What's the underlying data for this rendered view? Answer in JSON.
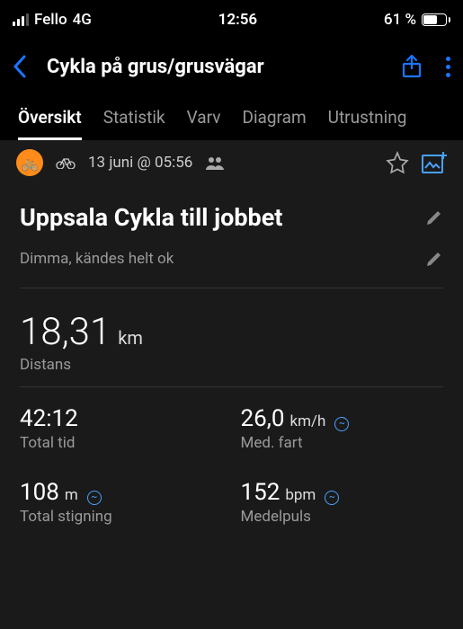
{
  "status": {
    "carrier": "Fello",
    "network": "4G",
    "time": "12:56",
    "battery_pct": "61 %"
  },
  "header": {
    "title": "Cykla på grus/grusvägar"
  },
  "tabs": {
    "items": [
      "Översikt",
      "Statistik",
      "Varv",
      "Diagram",
      "Utrustning"
    ],
    "active": 0
  },
  "activity": {
    "date_line": "13 juni @ 05:56",
    "title": "Uppsala Cykla till jobbet",
    "notes": "Dimma, kändes helt ok"
  },
  "main": {
    "value": "18,31",
    "unit": "km",
    "label": "Distans"
  },
  "grid": {
    "time": {
      "value": "42:12",
      "unit": "",
      "label": "Total tid",
      "info": false
    },
    "speed": {
      "value": "26,0",
      "unit": "km/h",
      "label": "Med. fart",
      "info": true
    },
    "ascent": {
      "value": "108",
      "unit": "m",
      "label": "Total stigning",
      "info": true
    },
    "hr": {
      "value": "152",
      "unit": "bpm",
      "label": "Medelpuls",
      "info": true
    }
  }
}
